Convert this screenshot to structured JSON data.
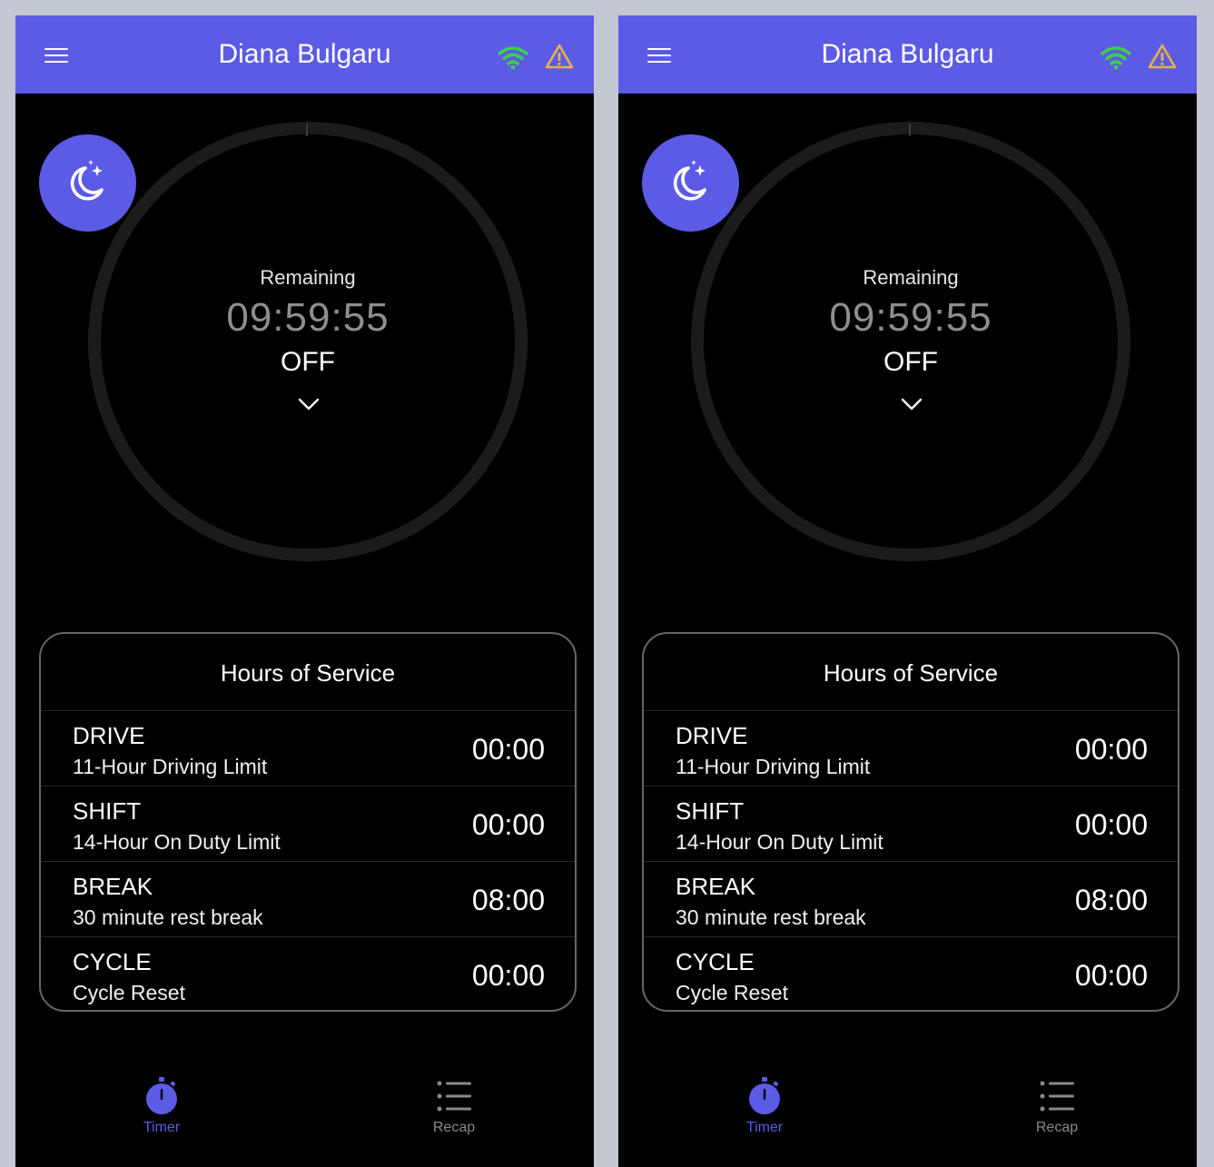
{
  "screens": [
    {
      "header": {
        "title": "Diana Bulgaru",
        "menu_icon": "hamburger-menu-icon",
        "wifi_icon": "wifi-icon",
        "warning_icon": "warning-icon"
      },
      "colors": {
        "accent": "#5b5be6",
        "wifi": "#3ecf4a",
        "warning": "#e8b341"
      },
      "timer": {
        "label": "Remaining",
        "time": "09:59:55",
        "status": "OFF",
        "toggle_icon": "chevron-down-icon",
        "mode_icon": "moon-stars-icon"
      },
      "hours_of_service": {
        "title": "Hours of Service",
        "rows": [
          {
            "name": "DRIVE",
            "description": "11-Hour Driving Limit",
            "value": "00:00"
          },
          {
            "name": "SHIFT",
            "description": "14-Hour On Duty Limit",
            "value": "00:00"
          },
          {
            "name": "BREAK",
            "description": "30 minute rest break",
            "value": "08:00"
          },
          {
            "name": "CYCLE",
            "description": "Cycle Reset",
            "value": "00:00"
          }
        ]
      },
      "tabs": [
        {
          "label": "Timer",
          "icon": "stopwatch-icon",
          "active": true
        },
        {
          "label": "Recap",
          "icon": "list-icon",
          "active": false
        }
      ]
    },
    {
      "header": {
        "title": "Diana Bulgaru",
        "menu_icon": "hamburger-menu-icon",
        "wifi_icon": "wifi-icon",
        "warning_icon": "warning-icon"
      },
      "colors": {
        "accent": "#5b5be6",
        "wifi": "#3ecf4a",
        "warning": "#e8b341"
      },
      "timer": {
        "label": "Remaining",
        "time": "09:59:55",
        "status": "OFF",
        "toggle_icon": "chevron-down-icon",
        "mode_icon": "moon-stars-icon"
      },
      "hours_of_service": {
        "title": "Hours of Service",
        "rows": [
          {
            "name": "DRIVE",
            "description": "11-Hour Driving Limit",
            "value": "00:00"
          },
          {
            "name": "SHIFT",
            "description": "14-Hour On Duty Limit",
            "value": "00:00"
          },
          {
            "name": "BREAK",
            "description": "30 minute rest break",
            "value": "08:00"
          },
          {
            "name": "CYCLE",
            "description": "Cycle Reset",
            "value": "00:00"
          }
        ]
      },
      "tabs": [
        {
          "label": "Timer",
          "icon": "stopwatch-icon",
          "active": true
        },
        {
          "label": "Recap",
          "icon": "list-icon",
          "active": false
        }
      ]
    }
  ]
}
